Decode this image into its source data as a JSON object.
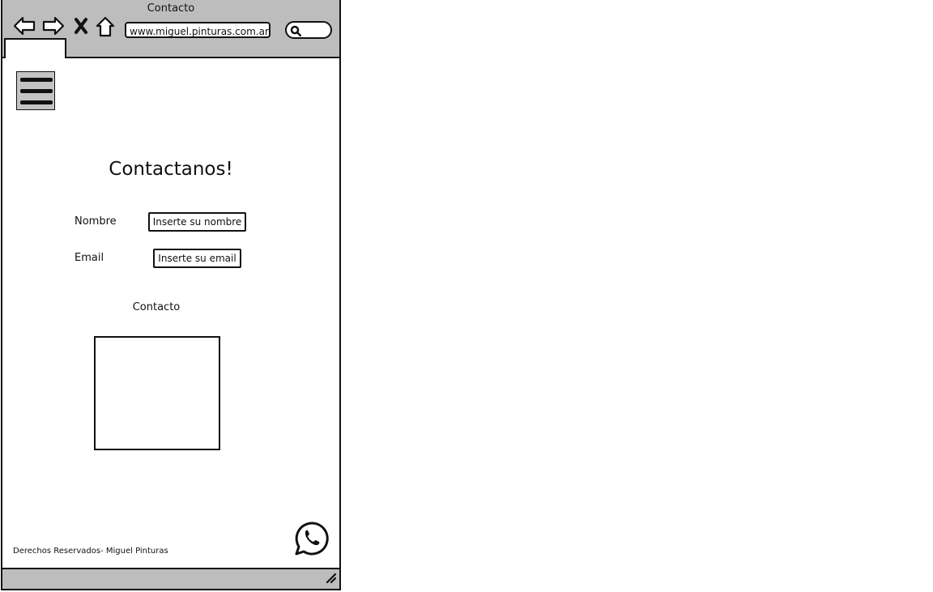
{
  "window": {
    "title": "Contacto",
    "url": "www.miguel.pinturas.com.ar"
  },
  "nav": {
    "back_icon": "arrow-left-icon",
    "forward_icon": "arrow-right-icon",
    "close_icon": "x-icon",
    "home_icon": "home-icon",
    "search_icon": "search-icon"
  },
  "menu": {
    "icon": "hamburger-icon"
  },
  "page": {
    "heading": "Contactanos!",
    "name_label": "Nombre",
    "name_placeholder": "Inserte su nombre",
    "email_label": "Email",
    "email_placeholder": "Inserte su email",
    "contact_label": "Contacto"
  },
  "footer": {
    "text": "Derechos Reservados- Miguel Pinturas",
    "whatsapp_icon": "whatsapp-icon"
  }
}
